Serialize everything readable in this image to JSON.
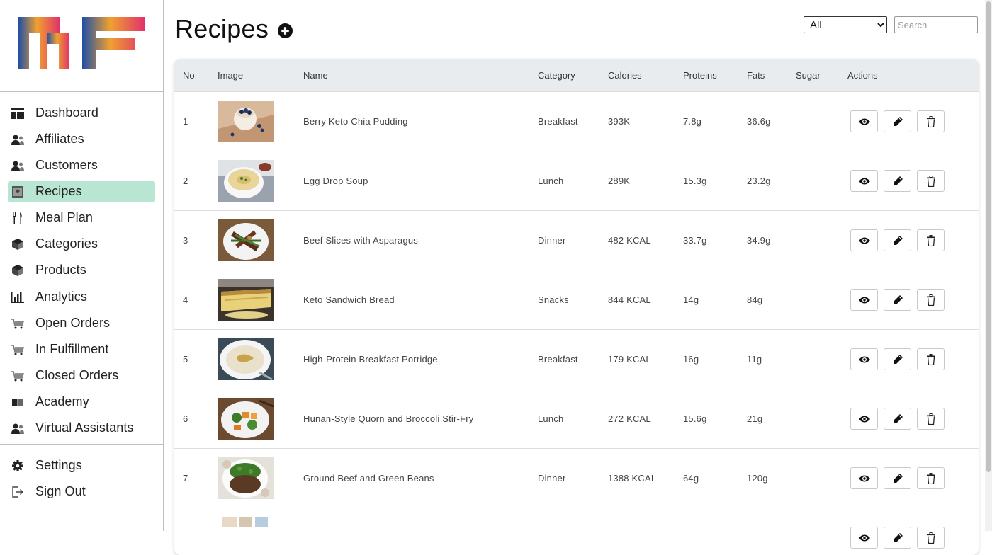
{
  "brand": {
    "logo_name": "MF logo",
    "colors": [
      "#1e4fa6",
      "#f0a030",
      "#e0336a"
    ]
  },
  "sidebar": {
    "items": [
      {
        "label": "Dashboard",
        "icon": "dashboard-icon",
        "active": false
      },
      {
        "label": "Affiliates",
        "icon": "users-icon",
        "active": false
      },
      {
        "label": "Customers",
        "icon": "users-icon",
        "active": false
      },
      {
        "label": "Recipes",
        "icon": "recipe-book-icon",
        "active": true
      },
      {
        "label": "Meal Plan",
        "icon": "utensils-icon",
        "active": false
      },
      {
        "label": "Categories",
        "icon": "box-icon",
        "active": false
      },
      {
        "label": "Products",
        "icon": "box-icon",
        "active": false
      },
      {
        "label": "Analytics",
        "icon": "chart-icon",
        "active": false
      },
      {
        "label": "Open Orders",
        "icon": "cart-icon",
        "active": false
      },
      {
        "label": "In Fulfillment",
        "icon": "cart-icon",
        "active": false
      },
      {
        "label": "Closed Orders",
        "icon": "cart-icon",
        "active": false
      },
      {
        "label": "Academy",
        "icon": "book-icon",
        "active": false
      },
      {
        "label": "Virtual Assistants",
        "icon": "users-icon",
        "active": false
      }
    ],
    "footer_items": [
      {
        "label": "Settings",
        "icon": "gear-icon"
      },
      {
        "label": "Sign Out",
        "icon": "sign-out-icon"
      }
    ],
    "active_color": "#b9e6d2"
  },
  "header": {
    "title": "Recipes",
    "add_icon": "plus-circle-icon",
    "filter": {
      "selected": "All",
      "options": [
        "All"
      ]
    },
    "search": {
      "placeholder": "Search",
      "value": ""
    }
  },
  "table": {
    "columns": [
      "No",
      "Image",
      "Name",
      "Category",
      "Calories",
      "Proteins",
      "Fats",
      "Sugar",
      "Actions"
    ],
    "rows": [
      {
        "no": "1",
        "image": "chia-pudding-photo",
        "name": "Berry Keto Chia Pudding",
        "category": "Breakfast",
        "calories": "393K",
        "proteins": "7.8g",
        "fats": "36.6g",
        "sugar": ""
      },
      {
        "no": "2",
        "image": "egg-drop-soup-photo",
        "name": "Egg Drop Soup",
        "category": "Lunch",
        "calories": "289K",
        "proteins": "15.3g",
        "fats": "23.2g",
        "sugar": ""
      },
      {
        "no": "3",
        "image": "beef-asparagus-photo",
        "name": "Beef Slices with Asparagus",
        "category": "Dinner",
        "calories": "482 KCAL",
        "proteins": "33.7g",
        "fats": "34.9g",
        "sugar": ""
      },
      {
        "no": "4",
        "image": "sandwich-bread-photo",
        "name": "Keto Sandwich Bread",
        "category": "Snacks",
        "calories": "844 KCAL",
        "proteins": "14g",
        "fats": "84g",
        "sugar": ""
      },
      {
        "no": "5",
        "image": "porridge-photo",
        "name": "High-Protein Breakfast Porridge",
        "category": "Breakfast",
        "calories": "179 KCAL",
        "proteins": "16g",
        "fats": "11g",
        "sugar": ""
      },
      {
        "no": "6",
        "image": "quorn-broccoli-photo",
        "name": "Hunan-Style Quorn and Broccoli Stir-Fry",
        "category": "Lunch",
        "calories": "272 KCAL",
        "proteins": "15.6g",
        "fats": "21g",
        "sugar": ""
      },
      {
        "no": "7",
        "image": "beef-green-beans-photo",
        "name": "Ground Beef and Green Beans",
        "category": "Dinner",
        "calories": "1388 KCAL",
        "proteins": "64g",
        "fats": "120g",
        "sugar": ""
      },
      {
        "no": "",
        "image": "partial-row-photo",
        "name": "",
        "category": "",
        "calories": "",
        "proteins": "",
        "fats": "",
        "sugar": ""
      }
    ],
    "actions": [
      "view-icon",
      "edit-icon",
      "delete-icon"
    ]
  }
}
